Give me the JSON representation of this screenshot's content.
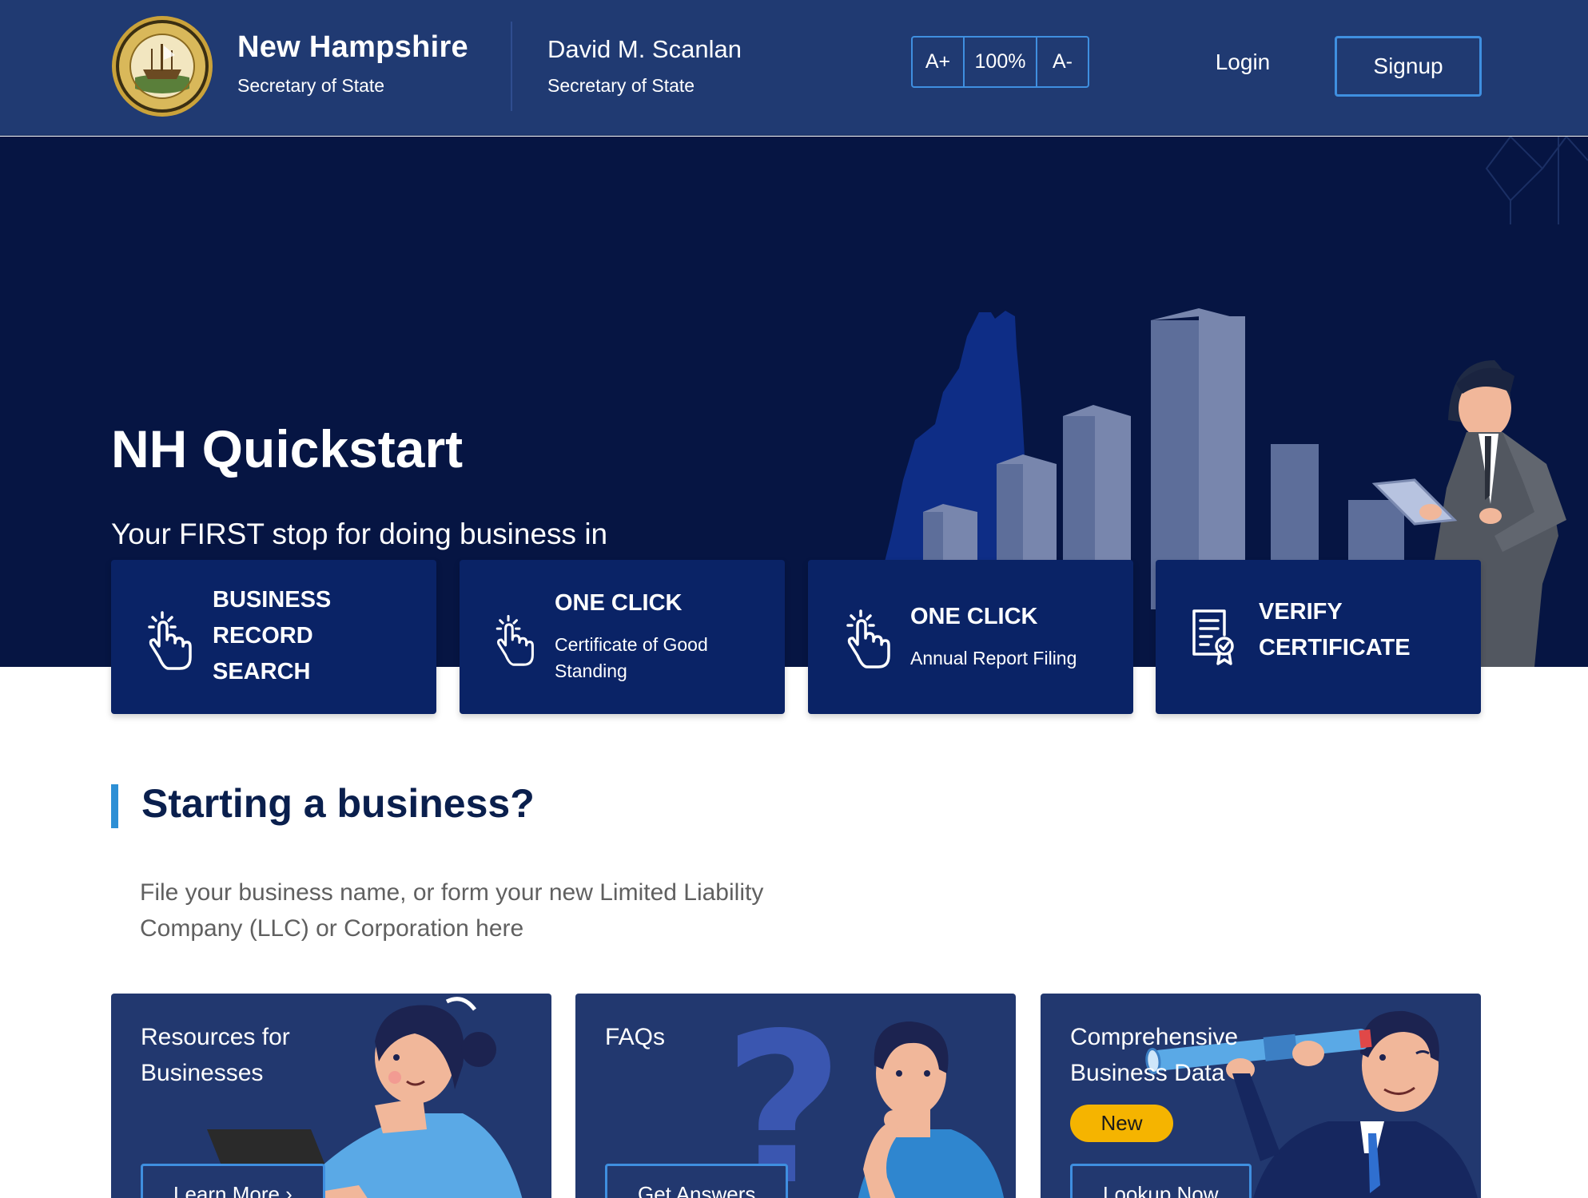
{
  "header": {
    "brand_title": "New Hampshire",
    "brand_subtitle": "Secretary of State",
    "officer_name": "David M. Scanlan",
    "officer_title": "Secretary of State",
    "font_controls": {
      "increase": "A+",
      "zoom": "100%",
      "decrease": "A-"
    },
    "login_label": "Login",
    "signup_label": "Signup"
  },
  "hero": {
    "title": "NH Quickstart",
    "subtitle": "Your FIRST stop for doing business in New Hampshire"
  },
  "quick_cards": [
    {
      "heading_line1": "BUSINESS",
      "heading_line2": "RECORD",
      "heading_line3": "SEARCH",
      "icon": "pointer-hand-icon"
    },
    {
      "heading": "ONE CLICK",
      "subtitle": "Certificate of Good Standing",
      "icon": "pointer-hand-icon"
    },
    {
      "heading": "ONE CLICK",
      "subtitle": "Annual Report Filing",
      "icon": "pointer-hand-icon"
    },
    {
      "heading_line1": "VERIFY",
      "heading_line2": "CERTIFICATE",
      "icon": "certificate-icon"
    }
  ],
  "section": {
    "title": "Starting a business?",
    "description": "File your business name, or form your new Limited Liability Company (LLC) or Corporation here"
  },
  "feature_cards": [
    {
      "title": "Resources for Businesses",
      "button": "Learn More ›"
    },
    {
      "title": "FAQs",
      "button": "Get Answers"
    },
    {
      "title": "Comprehensive Business Data",
      "badge": "New",
      "button": "Lookup Now"
    }
  ],
  "colors": {
    "header_bg": "#203a72",
    "hero_bg": "#061543",
    "card_bg": "#0a2366",
    "accent_blue": "#3f8fe0",
    "badge_yellow": "#f5b400",
    "section_title": "#0a1f4d"
  }
}
